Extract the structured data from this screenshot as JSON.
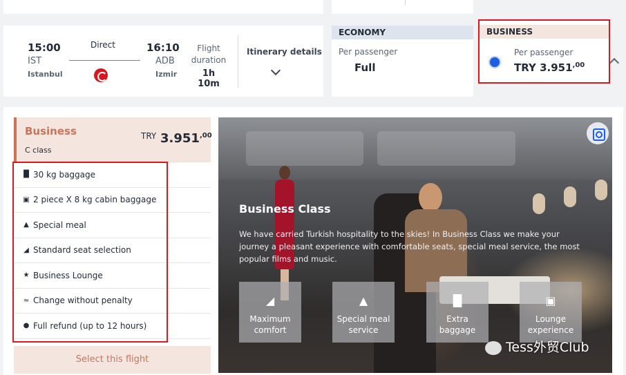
{
  "flight": {
    "dep_time": "15:00",
    "dep_code": "IST",
    "dep_city": "Istanbul",
    "stop_type": "Direct",
    "arr_time": "16:10",
    "arr_code": "ADB",
    "arr_city": "Izmir",
    "duration_label": "Flight duration",
    "duration": "1h 10m",
    "itinerary_label": "Itinerary details"
  },
  "economy": {
    "header": "ECONOMY",
    "per_passenger": "Per passenger",
    "value": "Full"
  },
  "business": {
    "header": "BUSINESS",
    "per_passenger": "Per passenger",
    "currency": "TRY",
    "price_main": "3.951",
    "price_cents": ",00",
    "selected": true
  },
  "fare_panel": {
    "title": "Business",
    "class_label": "C class",
    "currency": "TRY",
    "price_main": "3.951",
    "price_cents": ",00",
    "features": [
      {
        "icon": "baggage-icon",
        "label": "30 kg baggage"
      },
      {
        "icon": "cabin-bag-icon",
        "label": "2 piece X 8 kg cabin baggage"
      },
      {
        "icon": "meal-icon",
        "label": "Special meal"
      },
      {
        "icon": "seat-icon",
        "label": "Standard seat selection"
      },
      {
        "icon": "star-icon",
        "label": "Business Lounge"
      },
      {
        "icon": "change-icon",
        "label": "Change without penalty"
      },
      {
        "icon": "refund-icon",
        "label": "Full refund (up to 12 hours)"
      }
    ],
    "select_label": "Select this flight"
  },
  "promo": {
    "title": "Business Class",
    "description": "We have carried Turkish hospitality to the skies! In Business Class we make your journey a pleasant experience with comfortable seats, special meal service, the most popular films and music.",
    "buttons": [
      {
        "icon": "seat-icon",
        "line1": "Maximum",
        "line2": "comfort"
      },
      {
        "icon": "meal-icon",
        "line1": "Special meal",
        "line2": "service"
      },
      {
        "icon": "baggage-icon",
        "line1": "Extra",
        "line2": "baggage"
      },
      {
        "icon": "lounge-icon",
        "line1": "Lounge",
        "line2": "experience"
      }
    ]
  },
  "watermark": "Tess外贸Club",
  "colors": {
    "accent": "#c7765b",
    "highlight": "#e0161e",
    "radio": "#1c5fe0",
    "business_bg": "#f4e5df",
    "economy_bg": "#dde4ee"
  }
}
